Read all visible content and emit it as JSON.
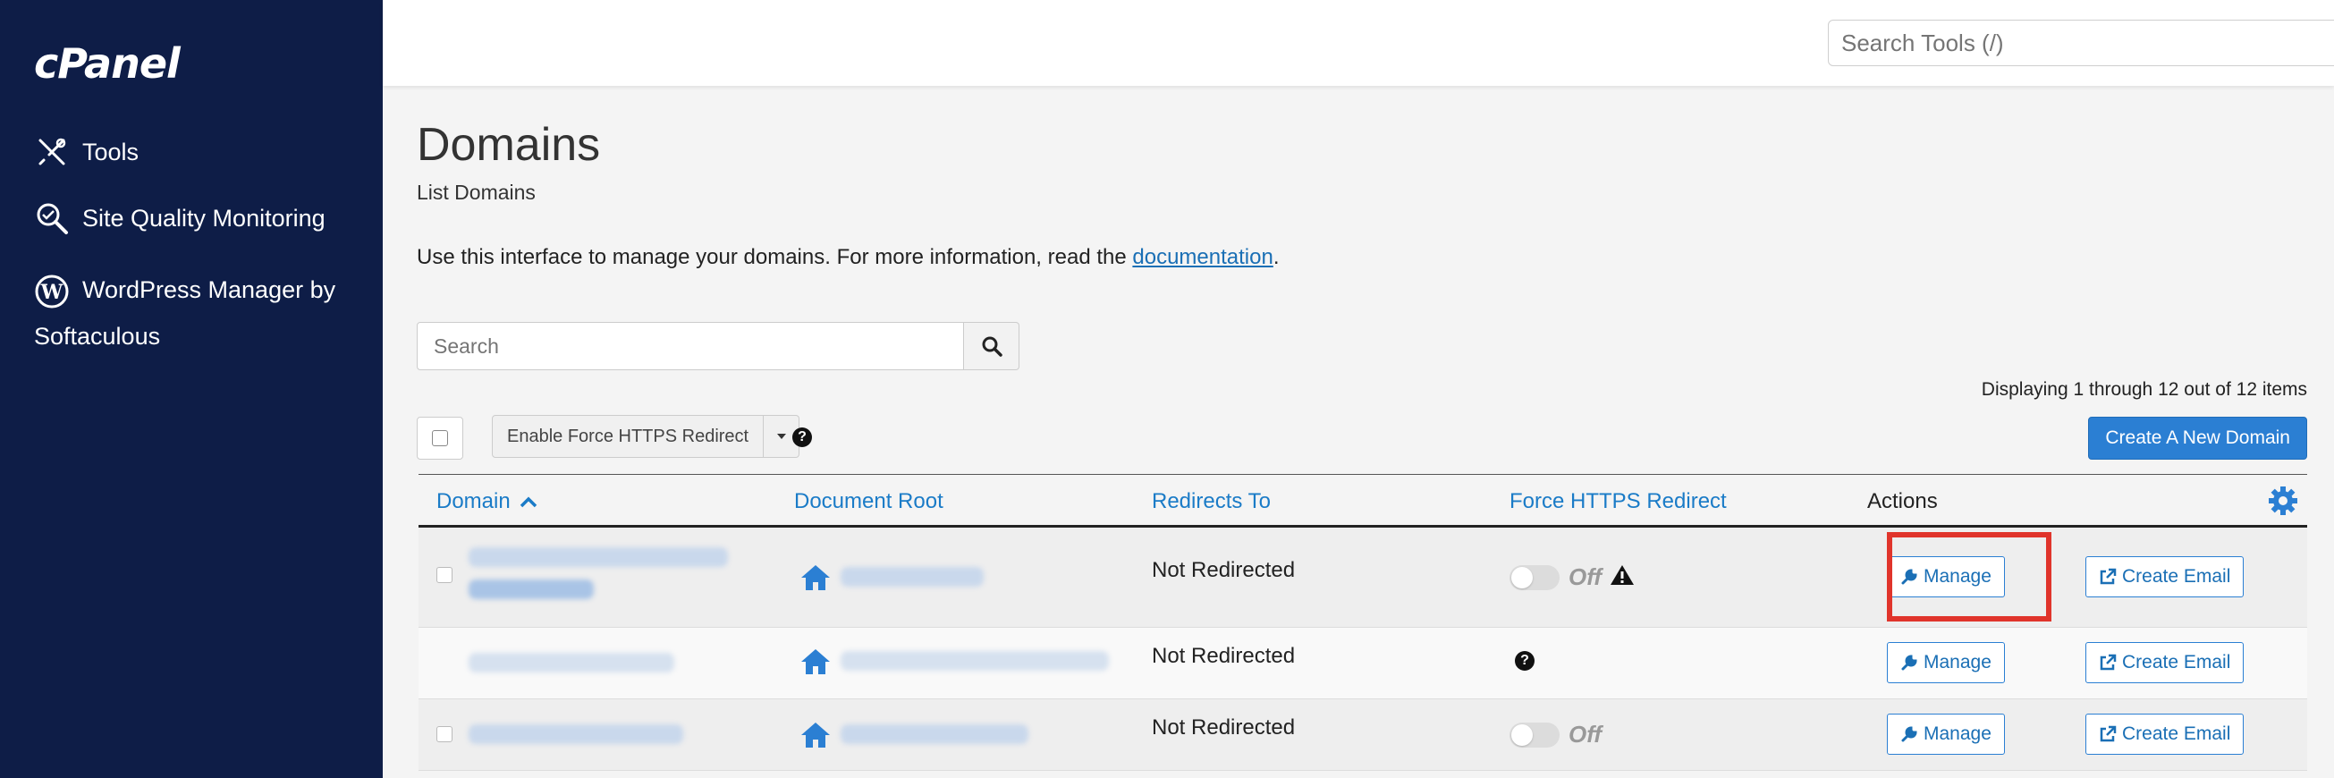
{
  "sidebar": {
    "logo": "cPanel",
    "items": [
      {
        "label": "Tools",
        "icon": "tools-icon"
      },
      {
        "label": "Site Quality Monitoring",
        "icon": "search-quality-icon"
      },
      {
        "label": "WordPress Manager by Softaculous",
        "icon": "wordpress-icon"
      }
    ]
  },
  "topbar": {
    "search_placeholder": "Search Tools (/)"
  },
  "page": {
    "title": "Domains",
    "subtitle": "List Domains",
    "intro_text": "Use this interface to manage your domains. For more information, read the ",
    "intro_link": "documentation",
    "intro_end": ".",
    "search_placeholder": "Search",
    "displaying": "Displaying 1 through 12 out of 12 items",
    "bulk_action": "Enable Force HTTPS Redirect",
    "create_button": "Create A New Domain"
  },
  "table": {
    "columns": [
      "Domain",
      "Document Root",
      "Redirects To",
      "Force HTTPS Redirect",
      "Actions"
    ],
    "rows": [
      {
        "redirects_to": "Not Redirected",
        "force_https": "Off",
        "manage": "Manage",
        "create_email": "Create Email"
      },
      {
        "redirects_to": "Not Redirected",
        "force_https": "",
        "manage": "Manage",
        "create_email": "Create Email"
      },
      {
        "redirects_to": "Not Redirected",
        "force_https": "Off",
        "manage": "Manage",
        "create_email": "Create Email"
      }
    ]
  },
  "colors": {
    "sidebar_bg": "#0e1d47",
    "link": "#1a7bc7",
    "primary": "#2b7fd3",
    "highlight": "#e0342b"
  }
}
